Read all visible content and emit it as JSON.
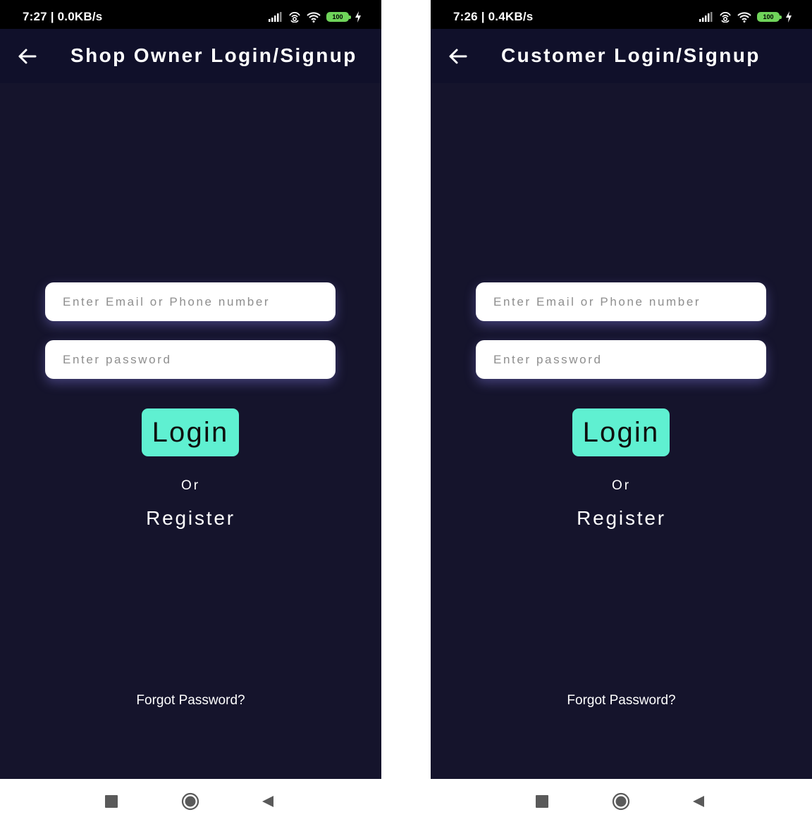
{
  "colors": {
    "status_bar": "#000000",
    "app_bar": "#10102a",
    "background": "#15142c",
    "accent": "#5ff0d1",
    "battery": "#6fd35a",
    "nav_bar": "#ffffff"
  },
  "screens": [
    {
      "status": {
        "time": "7:27 | 0.0KB/s",
        "battery": "100",
        "icons": [
          "signal-icon",
          "hotspot-icon",
          "wifi-icon",
          "battery-icon",
          "charging-icon"
        ]
      },
      "app_bar": {
        "title": "Shop Owner Login/Signup",
        "back_icon": "arrow-left-icon"
      },
      "form": {
        "email_placeholder": "Enter Email or Phone number",
        "email_value": "",
        "password_placeholder": "Enter password",
        "password_value": "",
        "login_label": "Login",
        "or_label": "Or",
        "register_label": "Register",
        "forgot_label": "Forgot Password?"
      },
      "nav": [
        "recents-icon",
        "home-icon",
        "back-triangle-icon"
      ]
    },
    {
      "status": {
        "time": "7:26 | 0.4KB/s",
        "battery": "100",
        "icons": [
          "signal-icon",
          "hotspot-icon",
          "wifi-icon",
          "battery-icon",
          "charging-icon"
        ]
      },
      "app_bar": {
        "title": "Customer Login/Signup",
        "back_icon": "arrow-left-icon"
      },
      "form": {
        "email_placeholder": "Enter Email or Phone number",
        "email_value": "",
        "password_placeholder": "Enter password",
        "password_value": "",
        "login_label": "Login",
        "or_label": "Or",
        "register_label": "Register",
        "forgot_label": "Forgot Password?"
      },
      "nav": [
        "recents-icon",
        "home-icon",
        "back-triangle-icon"
      ]
    }
  ]
}
